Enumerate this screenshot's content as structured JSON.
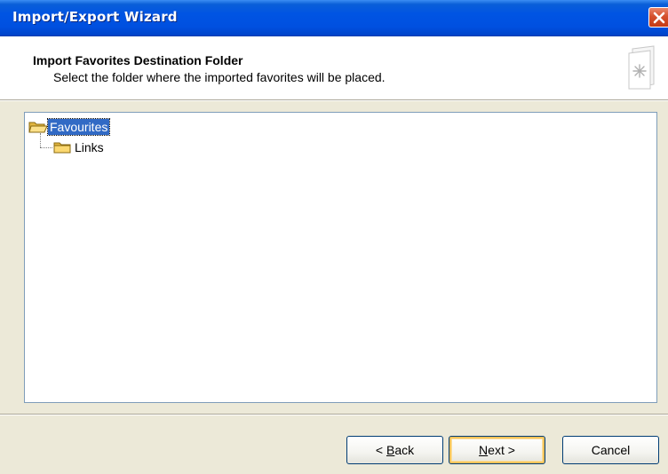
{
  "window": {
    "title": "Import/Export Wizard"
  },
  "header": {
    "title": "Import Favorites Destination Folder",
    "subtitle": "Select the folder where the imported favorites will be placed.",
    "icon": "wizard-page-star-icon"
  },
  "tree": {
    "items": [
      {
        "label": "Favourites",
        "selected": true,
        "icon": "folder-open-icon",
        "level": 0
      },
      {
        "label": "Links",
        "selected": false,
        "icon": "folder-icon",
        "level": 1
      }
    ]
  },
  "buttons": {
    "back": {
      "mnemonic": "B",
      "rest": "ack",
      "prefix": "< "
    },
    "next": {
      "mnemonic": "N",
      "rest": "ext",
      "suffix": " >"
    },
    "cancel": "Cancel"
  },
  "colors": {
    "titlebar": "#0054e3",
    "selection": "#316ac5",
    "close": "#d5502c",
    "dialog_bg": "#ece9d8"
  }
}
